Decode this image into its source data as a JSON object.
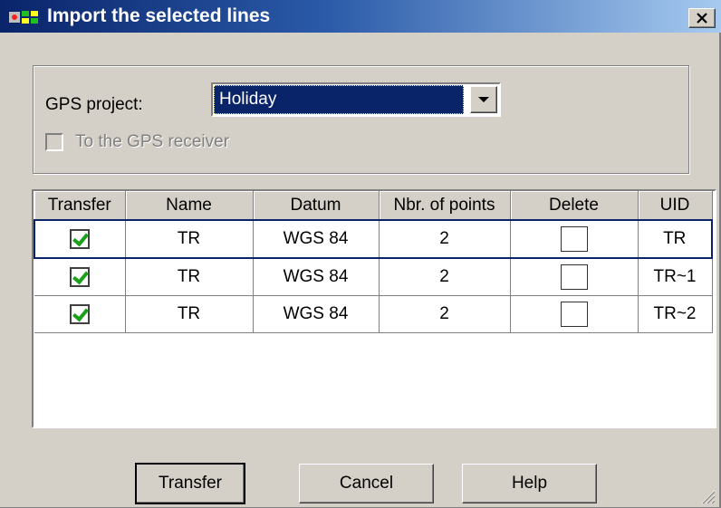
{
  "window": {
    "title": "Import the selected lines",
    "app_icon": "gps-app-icon",
    "close_icon": "close-icon",
    "colors": {
      "titlebar_start": "#0a246a",
      "titlebar_end": "#a6caf0",
      "face": "#d4d0c8",
      "selection": "#0a246a",
      "check": "#1aa01a"
    }
  },
  "project": {
    "label": "GPS project:",
    "selected": "Holiday",
    "dropdown_icon": "chevron-down-icon",
    "receiver_checkbox_label": "To the GPS receiver",
    "receiver_checked": false,
    "receiver_enabled": false
  },
  "table": {
    "columns": [
      "Transfer",
      "Name",
      "Datum",
      "Nbr. of points",
      "Delete",
      "UID"
    ],
    "rows": [
      {
        "transfer": true,
        "name": "TR",
        "datum": "WGS 84",
        "points": "2",
        "delete": false,
        "uid": "TR",
        "selected": true
      },
      {
        "transfer": true,
        "name": "TR",
        "datum": "WGS 84",
        "points": "2",
        "delete": false,
        "uid": "TR~1",
        "selected": false
      },
      {
        "transfer": true,
        "name": "TR",
        "datum": "WGS 84",
        "points": "2",
        "delete": false,
        "uid": "TR~2",
        "selected": false
      }
    ]
  },
  "buttons": {
    "transfer": "Transfer",
    "cancel": "Cancel",
    "help": "Help"
  }
}
